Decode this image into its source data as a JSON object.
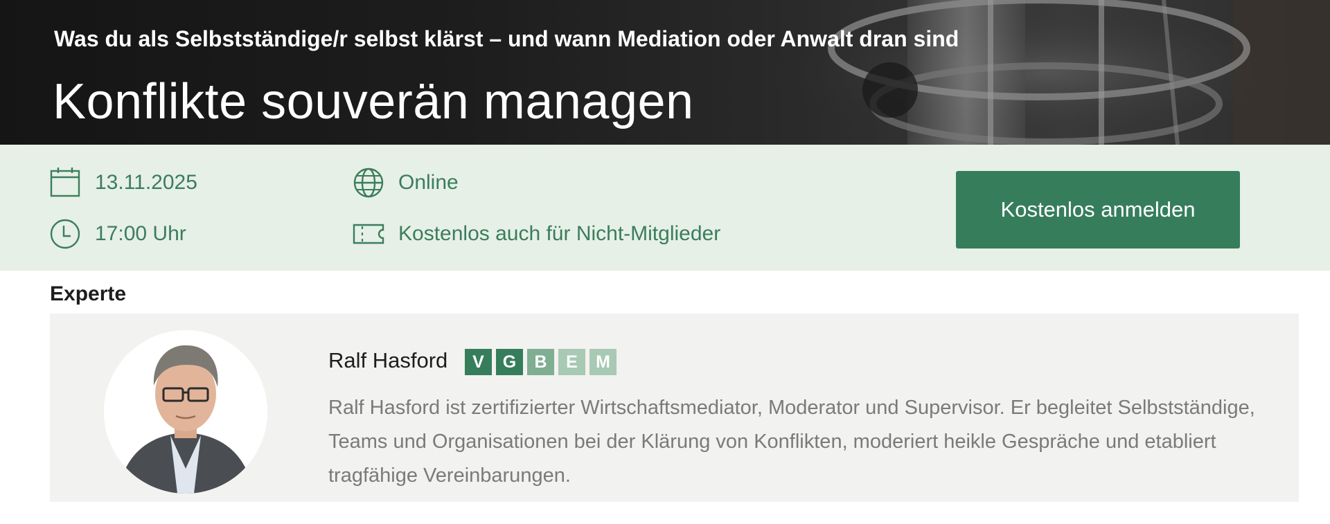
{
  "hero": {
    "subtitle": "Was du als Selbstständige/r selbst klärst – und wann Mediation oder Anwalt dran sind",
    "title": "Konflikte souverän managen"
  },
  "event": {
    "date": "13.11.2025",
    "time": "17:00 Uhr",
    "location": "Online",
    "price_note": "Kostenlos auch für Nicht-Mitglieder",
    "register_label": "Kostenlos anmelden"
  },
  "expert_section": {
    "label": "Experte",
    "name": "Ralf Hasford",
    "badges": [
      {
        "letter": "V",
        "color": "#367d5c"
      },
      {
        "letter": "G",
        "color": "#367d5c"
      },
      {
        "letter": "B",
        "color": "#7fae93"
      },
      {
        "letter": "E",
        "color": "#a8c9b3"
      },
      {
        "letter": "M",
        "color": "#a8c9b3"
      }
    ],
    "bio": "Ralf Hasford ist zertifizierter Wirtschaftsmediator, Moderator und Supervisor. Er begleitet Selbstständige, Teams und Organisationen bei der Klärung von Konflikten, moderiert heikle Gespräche und etabliert tragfähige Vereinbarungen."
  },
  "colors": {
    "accent": "#367d5c",
    "info_text": "#3b7d5a",
    "info_band": "#e6f0e7",
    "card_bg": "#f2f2f0"
  },
  "icons": {
    "date": "calendar-icon",
    "time": "clock-icon",
    "location": "globe-icon",
    "price": "ticket-icon"
  }
}
